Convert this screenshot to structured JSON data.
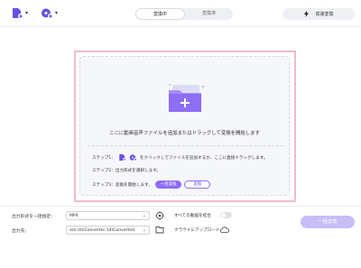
{
  "toolbar": {
    "add_file_icon": "add-file-icon",
    "add_dvd_icon": "add-dvd-icon",
    "tabs": [
      {
        "label": "変換中",
        "active": true
      },
      {
        "label": "変換済",
        "active": false
      }
    ],
    "fast_convert_label": "高速変換"
  },
  "dropzone": {
    "main_text": "ここに動画音声ファイルを追加またはドラッグして変換を開始します",
    "step1_prefix": "ステップ1：",
    "step1_text": "をクリックしてファイルを追加するか、ここに直接ドラッグします。",
    "step2_text": "ステップ2：出力形式を選択します。",
    "step3_text": "ステップ3：変換を開始します。",
    "convert_all_button": "一括変換",
    "convert_button": "変換"
  },
  "footer": {
    "output_format_label": "出力形式を一括指定：",
    "output_format_value": "MP4",
    "output_path_label": "出力先：",
    "output_path_value": "are UniConverter 14\\Converted",
    "merge_label": "すべての動画を結合",
    "cloud_upload_label": "クラウドにアップロード",
    "bulk_convert_button": "一括変換"
  },
  "colors": {
    "accent": "#8d6ef5",
    "dropzone_border": "#f3b9d0"
  }
}
